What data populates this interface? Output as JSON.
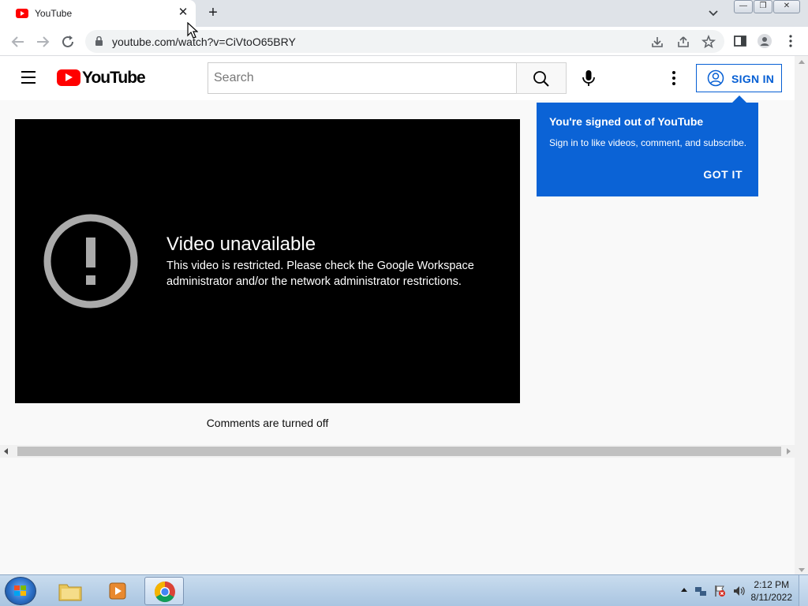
{
  "browser": {
    "tab_title": "YouTube",
    "tab_close_glyph": "✕",
    "new_tab_glyph": "+",
    "url": "youtube.com/watch?v=CiVtoO65BRY",
    "window_buttons": {
      "minimize": "—",
      "restore": "❐",
      "close": "✕"
    }
  },
  "youtube": {
    "logo_text": "YouTube",
    "search_placeholder": "Search",
    "sign_in_label": "SIGN IN",
    "tooltip": {
      "title": "You're signed out of YouTube",
      "body": "Sign in to like videos, comment, and subscribe.",
      "button": "GOT IT"
    },
    "player": {
      "error_title": "Video unavailable",
      "error_message": "This video is restricted. Please check the Google Workspace administrator and/or the network administrator restrictions."
    },
    "comments_status": "Comments are turned off"
  },
  "taskbar": {
    "time": "2:12 PM",
    "date": "8/11/2022",
    "items": [
      "windows-explorer",
      "media-player",
      "chrome"
    ]
  },
  "colors": {
    "youtube_red": "#ff0000",
    "sign_in_blue": "#065fd4",
    "tooltip_blue": "#0b63d6",
    "warning_gray": "#aaaaaa"
  },
  "icons": [
    "back-icon",
    "forward-icon",
    "reload-icon",
    "lock-icon",
    "install-icon",
    "share-icon",
    "star-icon",
    "side-panel-icon",
    "profile-icon",
    "menu-icon",
    "search-icon",
    "mic-icon",
    "kebab-icon",
    "account-icon",
    "warning-icon"
  ]
}
